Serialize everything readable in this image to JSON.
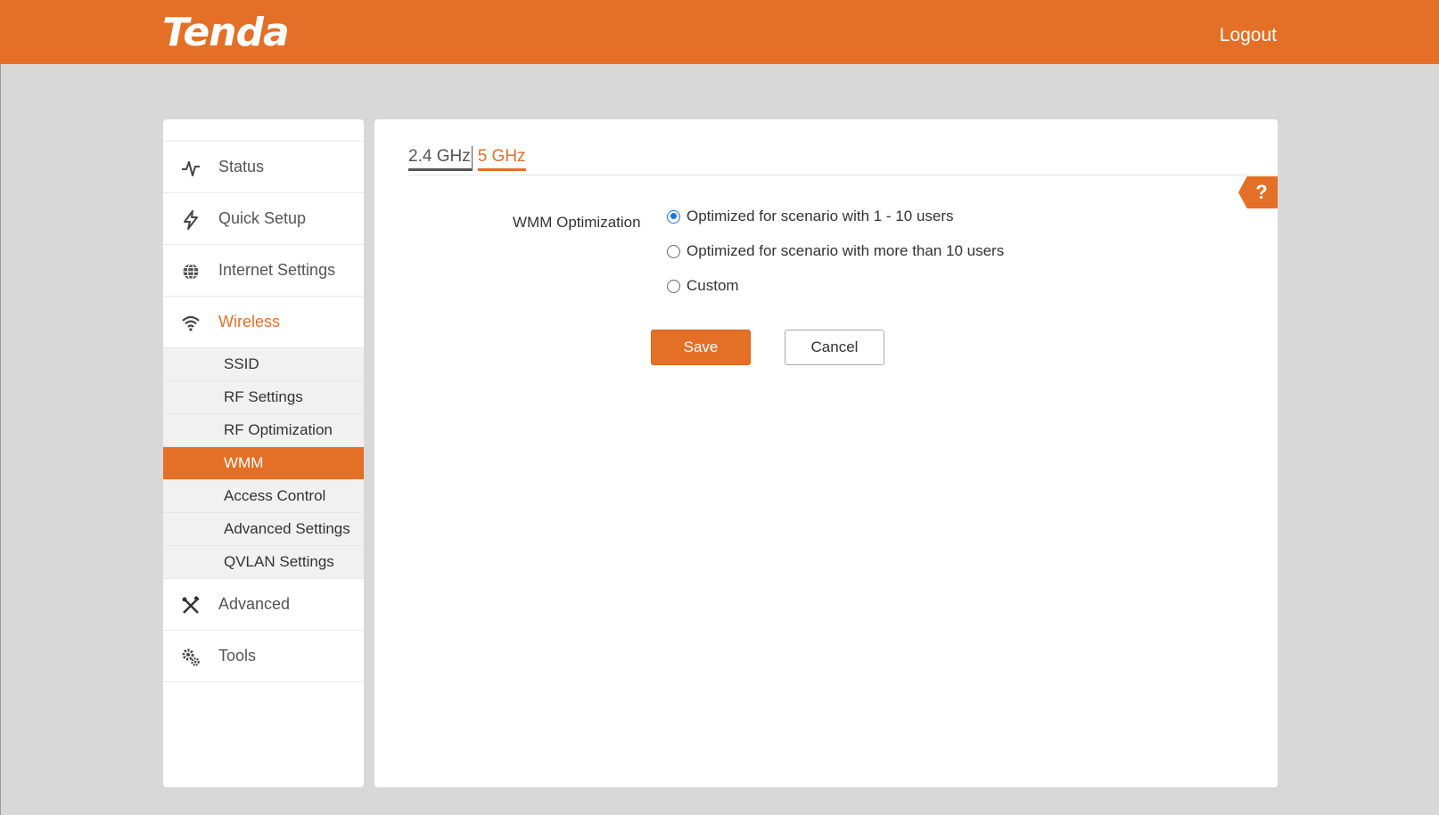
{
  "header": {
    "logo_text": "Tenda",
    "logout_label": "Logout",
    "bg_color": "#e37026"
  },
  "sidebar": {
    "items": [
      {
        "label": "Status",
        "icon": "pulse-icon"
      },
      {
        "label": "Quick Setup",
        "icon": "lightning-icon"
      },
      {
        "label": "Internet Settings",
        "icon": "globe-icon"
      },
      {
        "label": "Wireless",
        "icon": "wifi-icon",
        "active": true
      },
      {
        "label": "Advanced",
        "icon": "tools-icon"
      },
      {
        "label": "Tools",
        "icon": "gears-icon"
      }
    ],
    "wireless_sub": [
      {
        "label": "SSID"
      },
      {
        "label": "RF Settings"
      },
      {
        "label": "RF Optimization"
      },
      {
        "label": "WMM",
        "active": true
      },
      {
        "label": "Access Control"
      },
      {
        "label": "Advanced Settings"
      },
      {
        "label": "QVLAN Settings"
      }
    ]
  },
  "main": {
    "tabs": [
      {
        "label": "2.4 GHz"
      },
      {
        "label": "5 GHz",
        "active": true
      }
    ],
    "help_label": "?",
    "wmm_label": "WMM Optimization",
    "options": [
      {
        "label": "Optimized for scenario with 1 - 10 users",
        "checked": true
      },
      {
        "label": "Optimized for scenario with more than 10 users",
        "checked": false
      },
      {
        "label": "Custom",
        "checked": false
      }
    ],
    "save_label": "Save",
    "cancel_label": "Cancel"
  },
  "colors": {
    "accent": "#e37026",
    "radio_checked": "#1a73e8",
    "page_bg": "#d8d8d8"
  }
}
